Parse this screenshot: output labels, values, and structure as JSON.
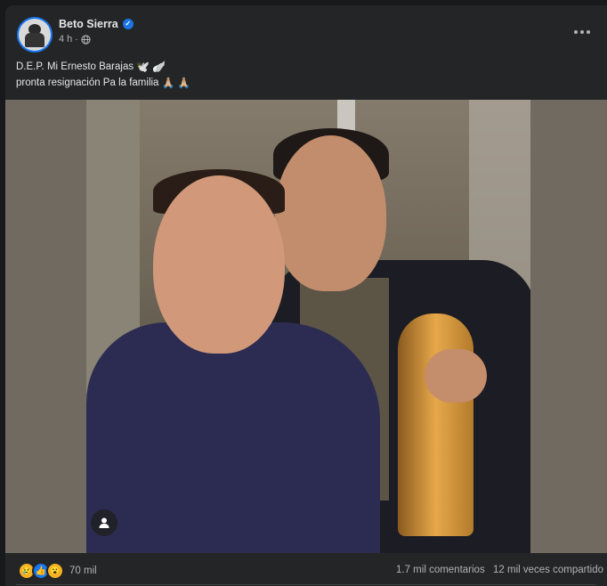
{
  "post": {
    "author": "Beto Sierra",
    "verified_icon": "verified-badge-icon",
    "time": "4 h",
    "separator": "·",
    "privacy_icon": "globe-icon",
    "more_icon": "more-options-icon",
    "text_lines": [
      {
        "text": "D.E.P. Mi Ernesto Barajas",
        "emojis": [
          "🕊️",
          "🪽"
        ]
      },
      {
        "text": "pronta resignación Pa la familia",
        "emojis": [
          "🙏🏼",
          "🙏🏼"
        ]
      }
    ],
    "photo_tag_icon": "person-icon"
  },
  "footer": {
    "reactions": [
      {
        "name": "sad-reaction-icon",
        "glyph": "😢"
      },
      {
        "name": "like-reaction-icon",
        "glyph": "👍"
      },
      {
        "name": "wow-reaction-icon",
        "glyph": "😮"
      }
    ],
    "reaction_count": "70 mil",
    "comments": "1.7 mil comentarios",
    "shares": "12 mil veces compartido"
  },
  "colors": {
    "background": "#18191a",
    "card": "#242526",
    "text_primary": "#e4e6eb",
    "text_secondary": "#b0b3b8",
    "accent": "#1877f2"
  }
}
